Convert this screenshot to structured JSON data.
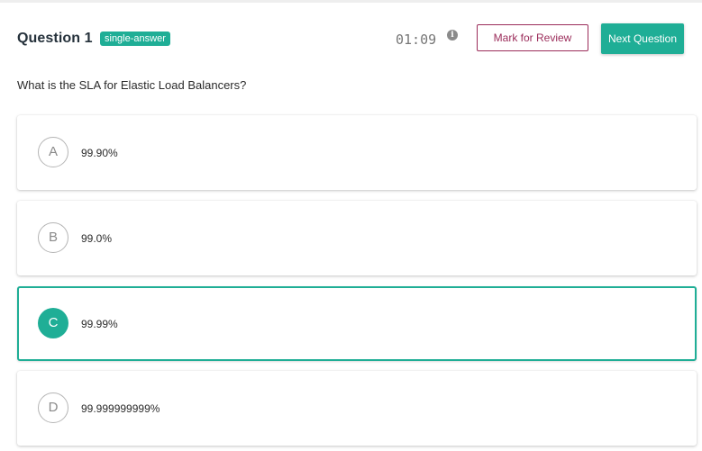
{
  "question": {
    "title": "Question 1",
    "badge": "single-answer",
    "timer": "01:09",
    "text": "What is the SLA for Elastic Load Balancers?"
  },
  "actions": {
    "mark_review_label": "Mark for Review",
    "next_label": "Next Question",
    "info_icon": "info-icon"
  },
  "options": [
    {
      "letter": "A",
      "text": "99.90%",
      "selected": false
    },
    {
      "letter": "B",
      "text": "99.0%",
      "selected": false
    },
    {
      "letter": "C",
      "text": "99.99%",
      "selected": true
    },
    {
      "letter": "D",
      "text": "99.999999999%",
      "selected": false
    }
  ],
  "colors": {
    "accent": "#1fae96",
    "review": "#9b2c5a",
    "title": "#25313b"
  }
}
